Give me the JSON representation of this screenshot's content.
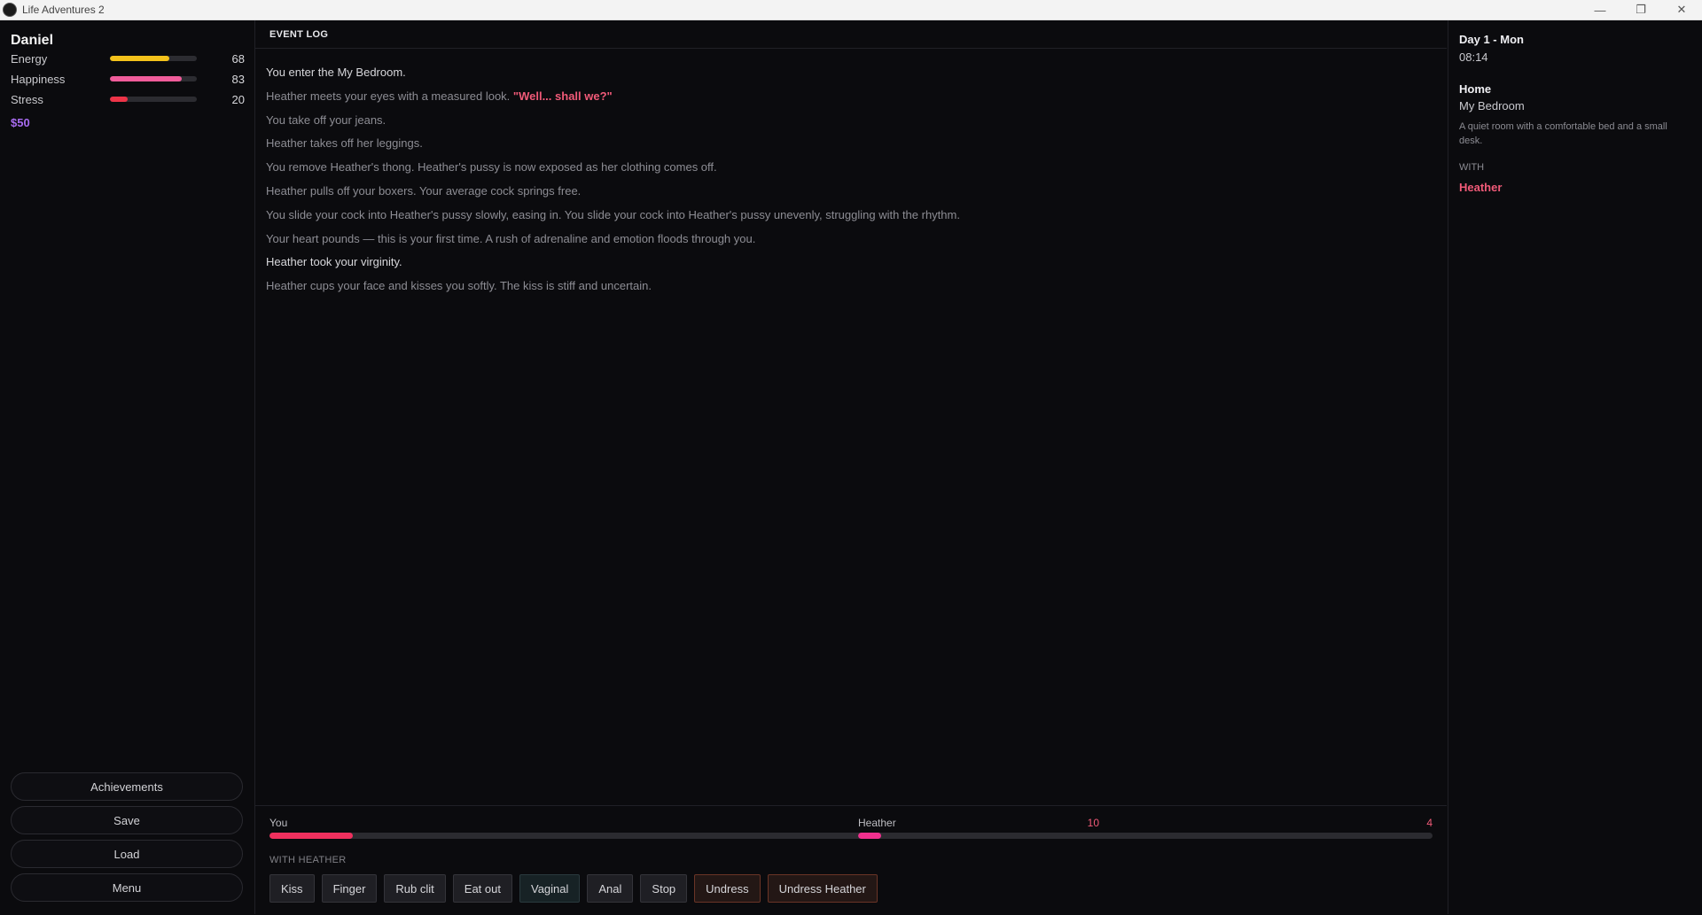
{
  "window": {
    "title": "Life Adventures 2",
    "controls": {
      "minimize": "—",
      "maximize": "❐",
      "close": "✕"
    }
  },
  "player": {
    "name": "Daniel",
    "stats": [
      {
        "label": "Energy",
        "value": 68,
        "color": "#f4c21b"
      },
      {
        "label": "Happiness",
        "value": 83,
        "color": "#f05c9a"
      },
      {
        "label": "Stress",
        "value": 20,
        "color": "#ee3448"
      }
    ],
    "money": "$50"
  },
  "sidebar_buttons": {
    "achievements": "Achievements",
    "save": "Save",
    "load": "Load",
    "menu": "Menu"
  },
  "event_log": {
    "header": "EVENT LOG",
    "lines": [
      {
        "text": "You enter the My Bedroom.",
        "bright": true
      },
      {
        "text": "Heather meets your eyes with a measured look. ",
        "quote": "\"Well... shall we?\""
      },
      {
        "text": "You take off your jeans."
      },
      {
        "text": "Heather takes off her leggings."
      },
      {
        "text": "You remove Heather's thong. Heather's pussy is now exposed as her clothing comes off."
      },
      {
        "text": "Heather pulls off your boxers. Your average cock springs free."
      },
      {
        "text": "You slide your cock into Heather's pussy slowly, easing in. You slide your cock into Heather's pussy unevenly, struggling with the rhythm."
      },
      {
        "text": "Your heart pounds — this is your first time. A rush of adrenaline and emotion floods through you."
      },
      {
        "text": "Heather took your virginity.",
        "bright": true
      },
      {
        "text": "Heather cups your face and kisses you softly. The kiss is stiff and uncertain."
      }
    ]
  },
  "arousal": {
    "you": {
      "label": "You",
      "value": "10",
      "fraction": 0.1,
      "color": "#f0305e"
    },
    "partner": {
      "label": "Heather",
      "value": "4",
      "fraction": 0.04,
      "color": "#f0308e"
    }
  },
  "actions": {
    "section_label": "WITH HEATHER",
    "buttons": [
      {
        "label": "Kiss",
        "style": "plain"
      },
      {
        "label": "Finger",
        "style": "plain"
      },
      {
        "label": "Rub clit",
        "style": "plain"
      },
      {
        "label": "Eat out",
        "style": "plain"
      },
      {
        "label": "Vaginal",
        "style": "teal"
      },
      {
        "label": "Anal",
        "style": "plain"
      },
      {
        "label": "Stop",
        "style": "plain"
      },
      {
        "label": "Undress",
        "style": "rust"
      },
      {
        "label": "Undress Heather",
        "style": "rust"
      }
    ]
  },
  "location": {
    "day": "Day 1 - Mon",
    "time": "08:14",
    "area": "Home",
    "room": "My Bedroom",
    "description": "A quiet room with a comfortable bed and a small desk.",
    "with_label": "WITH",
    "with_npc": "Heather"
  }
}
